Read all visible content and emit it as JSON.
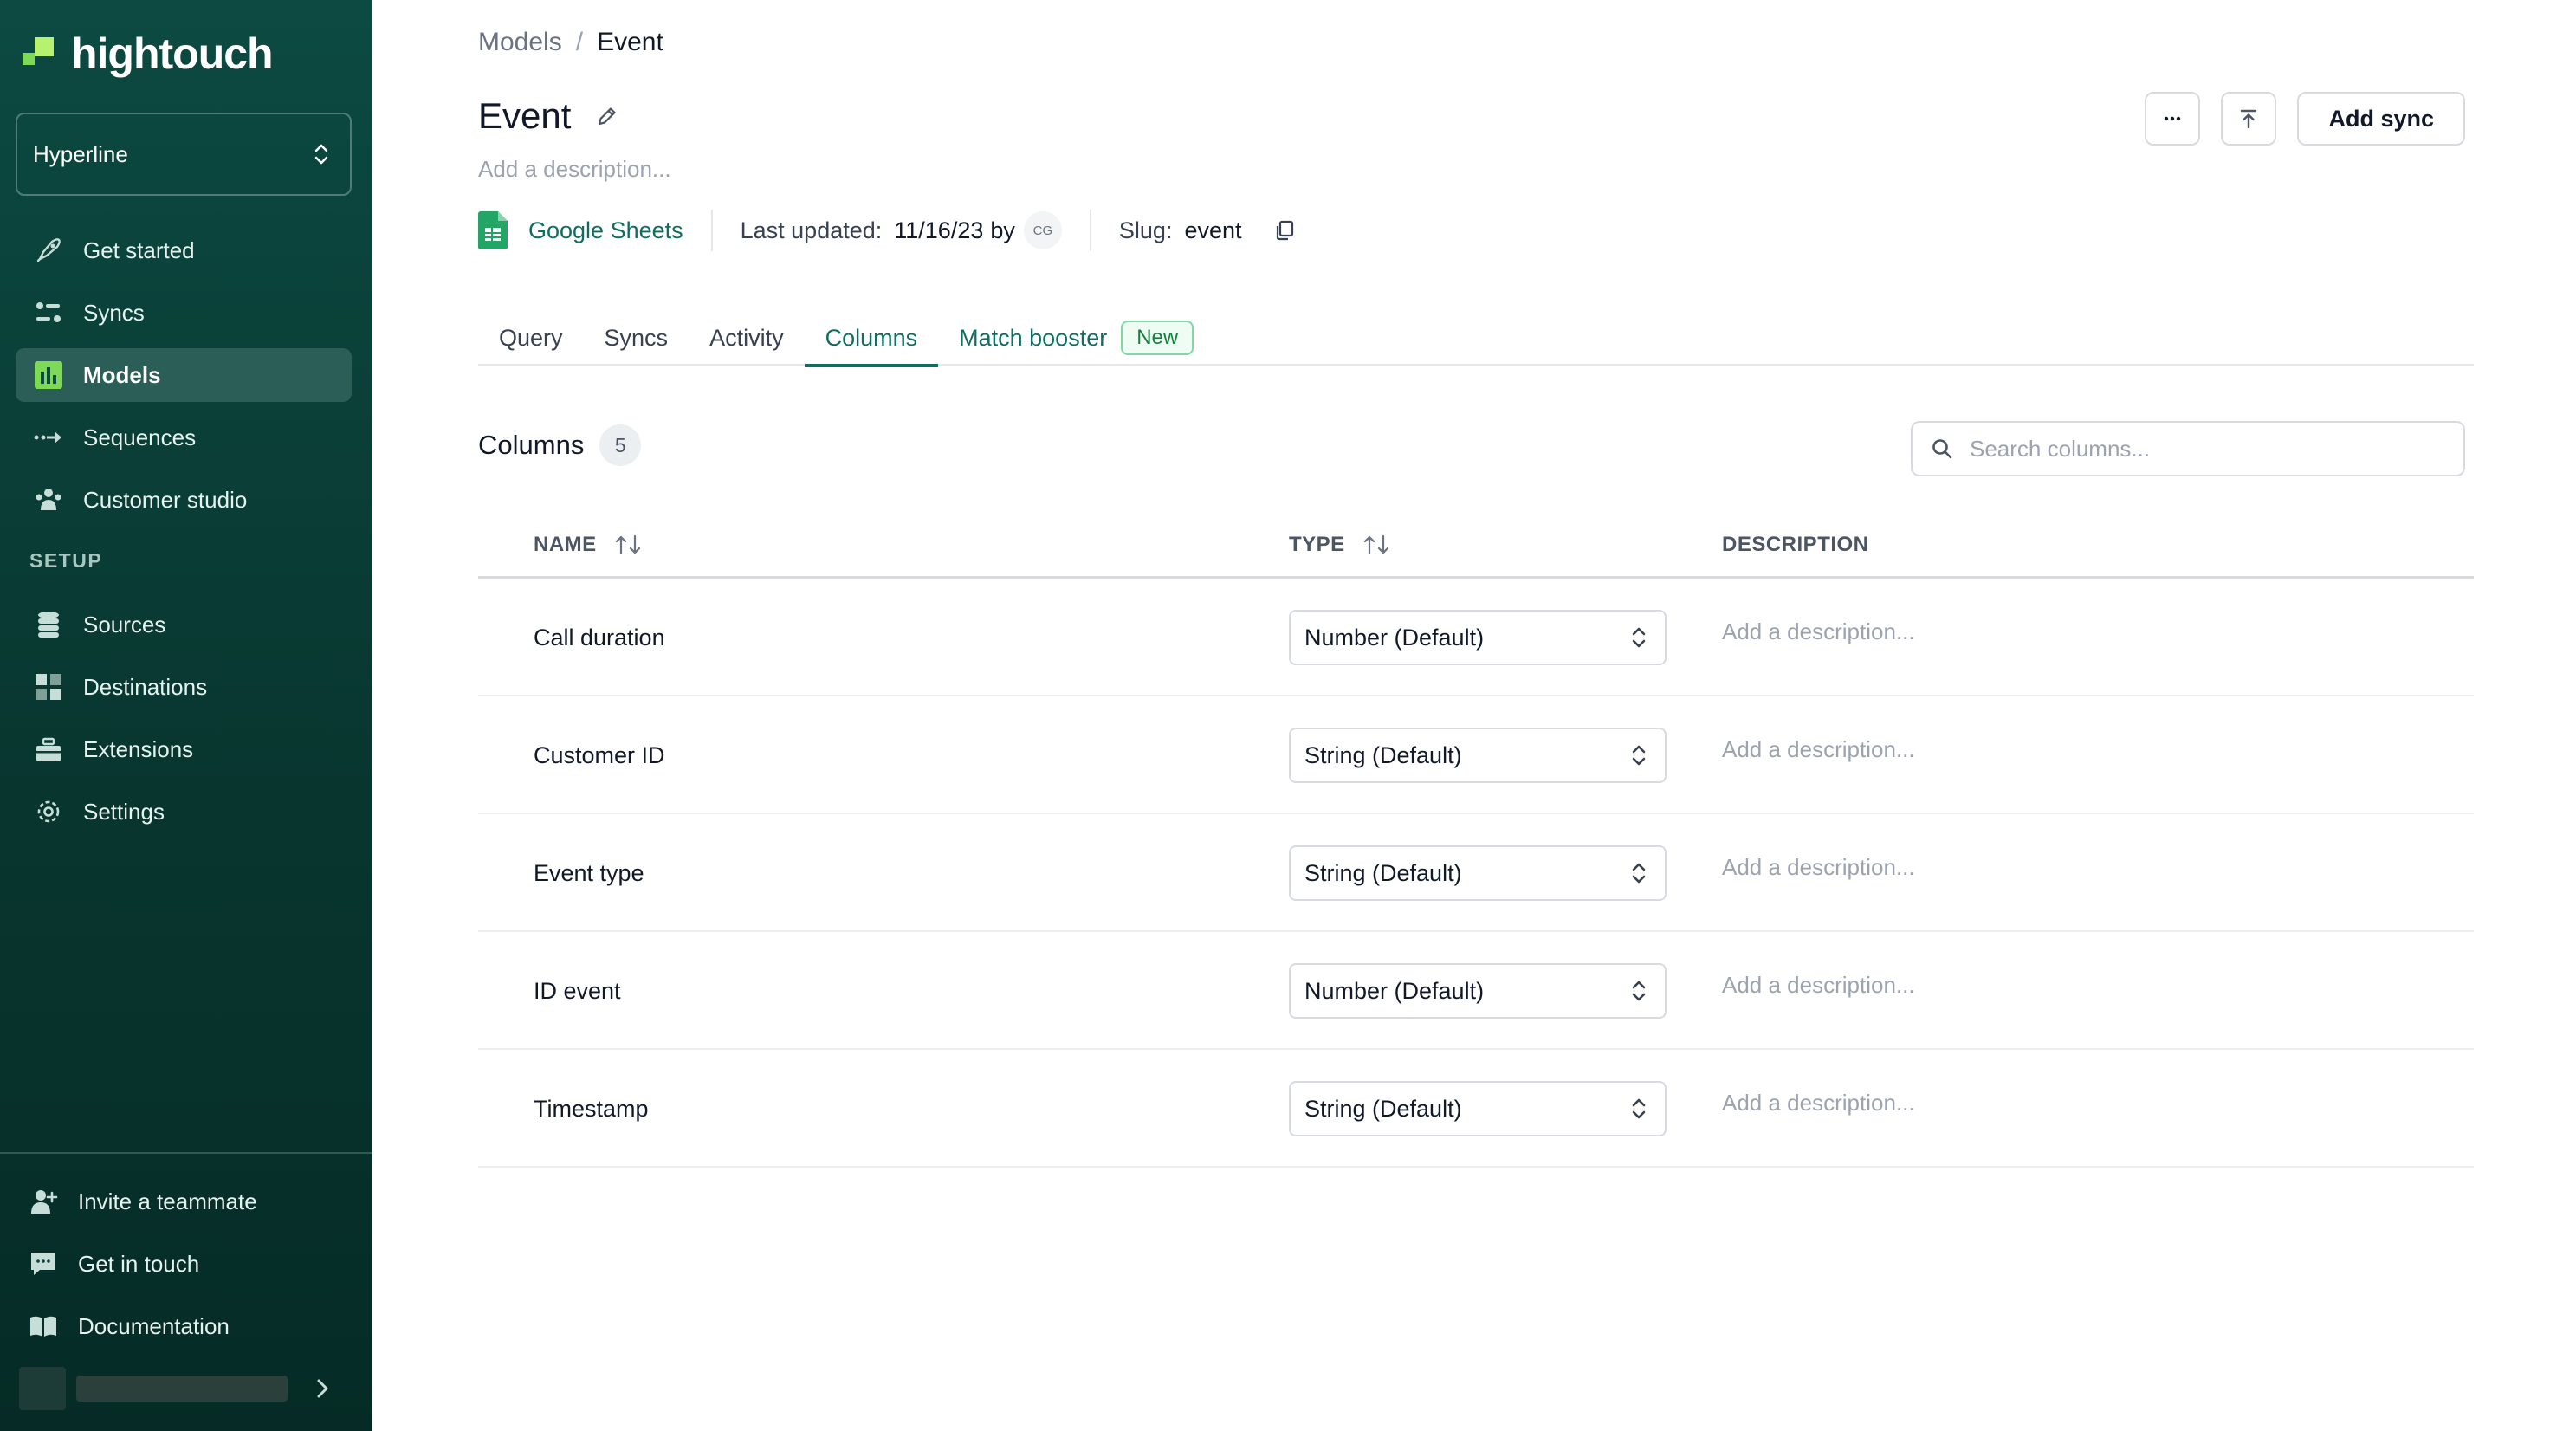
{
  "app": {
    "logo_text": "hightouch"
  },
  "workspace": {
    "name": "Hyperline"
  },
  "sidebar": {
    "items": [
      {
        "label": "Get started",
        "icon": "rocket-icon"
      },
      {
        "label": "Syncs",
        "icon": "syncs-icon"
      },
      {
        "label": "Models",
        "icon": "models-icon",
        "active": true
      },
      {
        "label": "Sequences",
        "icon": "sequences-icon"
      },
      {
        "label": "Customer studio",
        "icon": "customer-studio-icon"
      }
    ],
    "setup_label": "SETUP",
    "setup_items": [
      {
        "label": "Sources",
        "icon": "database-icon"
      },
      {
        "label": "Destinations",
        "icon": "destinations-icon"
      },
      {
        "label": "Extensions",
        "icon": "extensions-icon"
      },
      {
        "label": "Settings",
        "icon": "gear-icon"
      }
    ],
    "bottom_items": [
      {
        "label": "Invite a teammate",
        "icon": "add-user-icon"
      },
      {
        "label": "Get in touch",
        "icon": "chat-icon"
      },
      {
        "label": "Documentation",
        "icon": "book-icon"
      }
    ]
  },
  "breadcrumb": {
    "parent": "Models",
    "separator": "/",
    "current": "Event"
  },
  "header": {
    "title": "Event",
    "description_placeholder": "Add a description...",
    "add_sync_label": "Add sync"
  },
  "meta": {
    "source": "Google Sheets",
    "last_updated_label": "Last updated:",
    "last_updated_value": "11/16/23",
    "by_label": "by",
    "user_initials": "CG",
    "slug_label": "Slug:",
    "slug_value": "event"
  },
  "tabs": [
    {
      "label": "Query"
    },
    {
      "label": "Syncs"
    },
    {
      "label": "Activity"
    },
    {
      "label": "Columns",
      "active": true
    },
    {
      "label": "Match booster",
      "badge": "New"
    }
  ],
  "columns_section": {
    "title": "Columns",
    "count": "5",
    "search_placeholder": "Search columns...",
    "headers": {
      "name": "NAME",
      "type": "TYPE",
      "description": "DESCRIPTION"
    },
    "rows": [
      {
        "name": "Call duration",
        "type": "Number (Default)",
        "description_placeholder": "Add a description..."
      },
      {
        "name": "Customer ID",
        "type": "String (Default)",
        "description_placeholder": "Add a description..."
      },
      {
        "name": "Event type",
        "type": "String (Default)",
        "description_placeholder": "Add a description..."
      },
      {
        "name": "ID event",
        "type": "Number (Default)",
        "description_placeholder": "Add a description..."
      },
      {
        "name": "Timestamp",
        "type": "String (Default)",
        "description_placeholder": "Add a description..."
      }
    ]
  },
  "colors": {
    "sidebar_bg": "#0c4a42",
    "accent": "#0f6e62",
    "brand_green": "#7ed957",
    "new_badge": "#15803d"
  }
}
